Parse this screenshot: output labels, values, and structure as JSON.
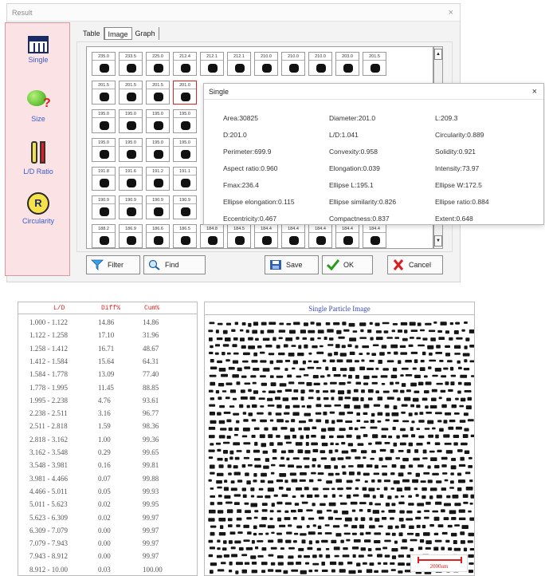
{
  "window": {
    "title": "Result",
    "close": "×"
  },
  "sidebar": [
    {
      "label": "Single",
      "icon": "grid-table-icon"
    },
    {
      "label": "Size",
      "icon": "blob-question-icon"
    },
    {
      "label": "L/D Ratio",
      "icon": "ld-ratio-icon"
    },
    {
      "label": "Circularity",
      "icon": "circularity-r-icon"
    }
  ],
  "tabs": [
    "Table",
    "Image",
    "Graph"
  ],
  "active_tab": "Image",
  "grid": {
    "rows": [
      [
        "235.0",
        "233.5",
        "225.0",
        "212.4",
        "212.1",
        "212.1",
        "210.0",
        "210.0",
        "210.0",
        "203.0",
        "201.5"
      ],
      [
        "201.5",
        "201.5",
        "201.5",
        "201.0"
      ],
      [
        "195.0",
        "195.0",
        "195.0",
        "195.0"
      ],
      [
        "195.0",
        "195.0",
        "195.0",
        "195.0"
      ],
      [
        "191.8",
        "191.6",
        "191.2",
        "191.1"
      ],
      [
        "190.9",
        "190.9",
        "190.9",
        "190.9"
      ],
      [
        "188.2",
        "186.9",
        "186.6",
        "186.5",
        "184.8",
        "184.5",
        "184.4",
        "184.4",
        "184.4",
        "184.4",
        "184.4"
      ]
    ],
    "selected": "201.0"
  },
  "buttons": {
    "filter": "Filter",
    "find": "Find",
    "save": "Save",
    "ok": "OK",
    "cancel": "Cancel"
  },
  "popup": {
    "title": "Single",
    "close": "×",
    "properties": [
      [
        "Area:30825",
        "Diameter:201.0",
        "L:209.3"
      ],
      [
        "D:201.0",
        "L/D:1.041",
        "Circularity:0.889"
      ],
      [
        "Perimeter:699.9",
        "Convexity:0.958",
        "Solidity:0.921"
      ],
      [
        "Aspect ratio:0.960",
        "Elongation:0.039",
        "Intensity:73.97"
      ],
      [
        "Fmax:236.4",
        "Ellipse L:195.1",
        "Ellipse W:172.5"
      ],
      [
        "Ellipse elongation:0.115",
        "Ellipse similarity:0.826",
        "Ellipse ratio:0.884"
      ],
      [
        "Eccentricity:0.467",
        "Compactness:0.837",
        "Extent:0.648"
      ]
    ]
  },
  "ld_table": {
    "headers": [
      "L/D",
      "Diff%",
      "Cum%"
    ],
    "rows": [
      [
        "1.000 - 1.122",
        "14.86",
        "14.86"
      ],
      [
        "1.122 - 1.258",
        "17.10",
        "31.96"
      ],
      [
        "1.258 - 1.412",
        "16.71",
        "48.67"
      ],
      [
        "1.412 - 1.584",
        "15.64",
        "64.31"
      ],
      [
        "1.584 - 1.778",
        "13.09",
        "77.40"
      ],
      [
        "1.778 - 1.995",
        "11.45",
        "88.85"
      ],
      [
        "1.995 - 2.238",
        "4.76",
        "93.61"
      ],
      [
        "2.238 - 2.511",
        "3.16",
        "96.77"
      ],
      [
        "2.511 - 2.818",
        "1.59",
        "98.36"
      ],
      [
        "2.818 - 3.162",
        "1.00",
        "99.36"
      ],
      [
        "3.162 - 3.548",
        "0.29",
        "99.65"
      ],
      [
        "3.548 - 3.981",
        "0.16",
        "99.81"
      ],
      [
        "3.981 - 4.466",
        "0.07",
        "99.88"
      ],
      [
        "4.466 - 5.011",
        "0.05",
        "99.93"
      ],
      [
        "5.011 - 5.623",
        "0.02",
        "99.95"
      ],
      [
        "5.623 - 6.309",
        "0.02",
        "99.97"
      ],
      [
        "6.309 - 7.079",
        "0.00",
        "99.97"
      ],
      [
        "7.079 - 7.943",
        "0.00",
        "99.97"
      ],
      [
        "7.943 - 8.912",
        "0.00",
        "99.97"
      ],
      [
        "8.912 - 10.00",
        "0.03",
        "100.00"
      ]
    ]
  },
  "particle_image": {
    "title": "Single Particle Image",
    "scale_label": "2000um"
  },
  "colors": {
    "accent_red": "#e02020",
    "label_blue": "#3a5cc8",
    "sidebar_bg": "#fbe3e5"
  }
}
